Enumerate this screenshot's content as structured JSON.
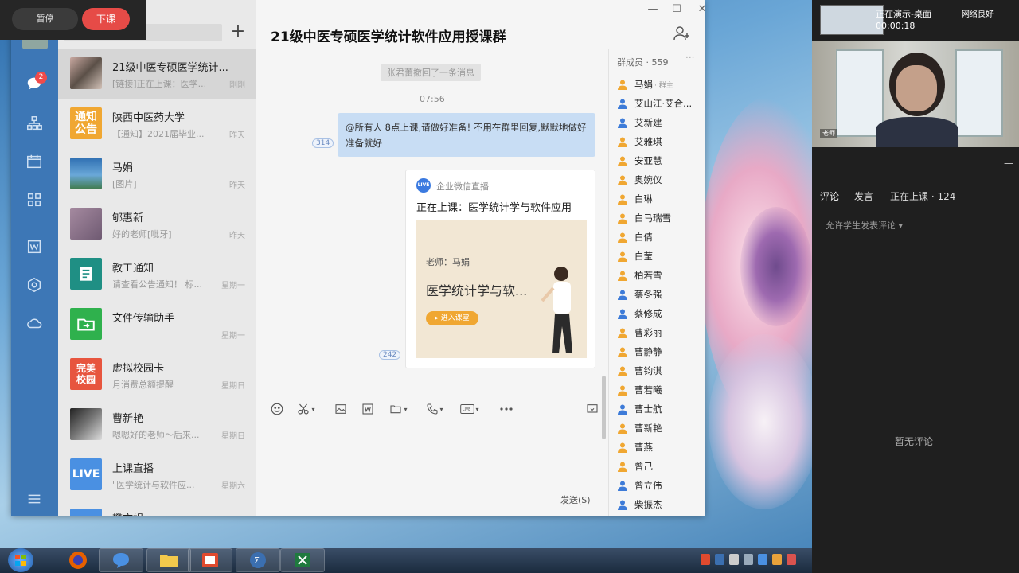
{
  "live_controls": {
    "pause_label": "暂停",
    "end_label": "下课"
  },
  "nav": {
    "badge": "2"
  },
  "chat_list": [
    {
      "name": "21级中医专硕医学统计...",
      "preview": "[链接]正在上课：医学...",
      "time": "刚刚"
    },
    {
      "name": "陕西中医药大学",
      "preview": "【通知】2021届毕业...",
      "time": "昨天",
      "avatar_text": "通知公告"
    },
    {
      "name": "马娟",
      "preview": "[图片]",
      "time": "昨天"
    },
    {
      "name": "郇惠新",
      "preview": "好的老师[呲牙]",
      "time": "昨天"
    },
    {
      "name": "教工通知",
      "preview": "请查看公告通知！ 标...",
      "time": "星期一"
    },
    {
      "name": "文件传输助手",
      "preview": "",
      "time": "星期一"
    },
    {
      "name": "虚拟校园卡",
      "preview": "月消费总额提醒",
      "time": "星期日",
      "avatar_text": "完美校园"
    },
    {
      "name": "曹新艳",
      "preview": "嗯嗯好的老师～后来...",
      "time": "星期日"
    },
    {
      "name": "上课直播",
      "preview": "\"医学统计与软件应...",
      "time": "星期六",
      "avatar_text": "LIVE"
    },
    {
      "name": "樊文娟",
      "preview": "",
      "time": ""
    }
  ],
  "chat": {
    "title": "21级中医专硕医学统计软件应用授课群",
    "system_msg": "张君蕾撤回了一条消息",
    "time": "07:56",
    "message": "@所有人  8点上课,请做好准备!  不用在群里回复,默默地做好准备就好",
    "read_count_1": "314",
    "read_count_2": "242",
    "live_source": "企业微信直播",
    "live_badge": "LIVE",
    "live_title": "正在上课：医学统计学与软件应用",
    "poster_teacher": "老师：马娟",
    "poster_course": "医学统计学与软...",
    "poster_enter": "▸ 进入课堂",
    "send_label": "发送(S)"
  },
  "window_controls": {
    "minimize": "—",
    "maximize": "☐",
    "close": "✕"
  },
  "members": {
    "header": "群成员 · 559",
    "more": "···",
    "owner_tag": "群主",
    "list": [
      {
        "name": "马娟",
        "color": "#f0a732"
      },
      {
        "name": "艾山江·艾合...",
        "color": "#3d7bd8"
      },
      {
        "name": "艾新建",
        "color": "#3d7bd8"
      },
      {
        "name": "艾雅琪",
        "color": "#f0a732"
      },
      {
        "name": "安亚慧",
        "color": "#f0a732"
      },
      {
        "name": "奥婉仪",
        "color": "#f0a732"
      },
      {
        "name": "白琳",
        "color": "#f0a732"
      },
      {
        "name": "白马瑞雪",
        "color": "#f0a732"
      },
      {
        "name": "白倩",
        "color": "#f0a732"
      },
      {
        "name": "白莹",
        "color": "#f0a732"
      },
      {
        "name": "柏若雪",
        "color": "#f0a732"
      },
      {
        "name": "蔡冬强",
        "color": "#3d7bd8"
      },
      {
        "name": "蔡修成",
        "color": "#3d7bd8"
      },
      {
        "name": "曹彩丽",
        "color": "#f0a732"
      },
      {
        "name": "曹静静",
        "color": "#f0a732"
      },
      {
        "name": "曹钧淇",
        "color": "#f0a732"
      },
      {
        "name": "曹若曦",
        "color": "#f0a732"
      },
      {
        "name": "曹士航",
        "color": "#3d7bd8"
      },
      {
        "name": "曹新艳",
        "color": "#f0a732"
      },
      {
        "name": "曹燕",
        "color": "#f0a732"
      },
      {
        "name": "曾己",
        "color": "#f0a732"
      },
      {
        "name": "曾立伟",
        "color": "#3d7bd8"
      },
      {
        "name": "柴振杰",
        "color": "#3d7bd8"
      }
    ]
  },
  "live_panel": {
    "status": "正在演示-桌面",
    "elapsed": "00:00:18",
    "network": "网络良好",
    "cam_label": "老师",
    "minimize": "—",
    "tabs": [
      "评论",
      "发言",
      "正在上课 · 124"
    ],
    "permission": "允许学生发表评论 ▾",
    "empty": "暂无评论"
  }
}
